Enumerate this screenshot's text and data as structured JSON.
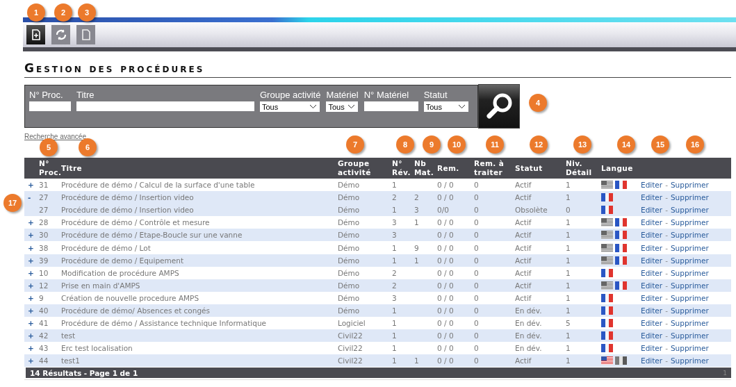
{
  "toolbar": {
    "buttons": [
      {
        "kind": "new",
        "selected": true
      },
      {
        "kind": "refresh",
        "selected": false
      },
      {
        "kind": "document",
        "selected": false
      }
    ]
  },
  "title": "Gestion des procédures",
  "filters": {
    "fields": [
      {
        "kind": "text",
        "label": "N° Proc."
      },
      {
        "kind": "text",
        "label": "Titre"
      },
      {
        "kind": "select",
        "label": "Groupe activité",
        "value": "Tous"
      },
      {
        "kind": "select",
        "label": "Matériel",
        "value": "Tous"
      },
      {
        "kind": "text",
        "label": "N° Matériel"
      },
      {
        "kind": "select",
        "label": "Statut",
        "value": "Tous"
      }
    ]
  },
  "advanced_search": "Recherche avancée",
  "table": {
    "columns": [
      "",
      "N°\nProc.",
      "Titre",
      "Groupe\nactivité",
      "N°\nRév.",
      "Nb\nMat.",
      "Rem.",
      "Rem. à\ntraiter",
      "Statut",
      "Niv.\nDétail",
      "Langue",
      ""
    ],
    "rows": [
      {
        "toggle": "+",
        "proc": "31",
        "titre": "Procédure de démo / Calcul de la surface d'une table",
        "groupe": "Démo",
        "rev": "1",
        "nb_mat": "",
        "rem": "0 / 0",
        "rem_traiter": "0",
        "statut": "Actif",
        "niv": "1",
        "langues": [
          {
            "kind": "us",
            "active": false
          },
          {
            "kind": "fr",
            "active": true
          }
        ],
        "edit": "Editer",
        "separator": "-",
        "delete": "Supprimer"
      },
      {
        "toggle": "-",
        "proc": "27",
        "titre": "Procédure de démo / Insertion video",
        "groupe": "Démo",
        "rev": "2",
        "nb_mat": "2",
        "rem": "0 / 0",
        "rem_traiter": "0",
        "statut": "Actif",
        "niv": "1",
        "langues": [
          {
            "kind": "fr",
            "active": true
          }
        ],
        "edit": "Editer",
        "separator": "-",
        "delete": "Supprimer"
      },
      {
        "proc": "27",
        "titre": "Procédure de démo / Insertion video",
        "groupe": "Démo",
        "rev": "1",
        "nb_mat": "3",
        "rem": "0/0",
        "rem_traiter": "0",
        "statut": "Obsolète",
        "niv": "0",
        "langues": [
          {
            "kind": "fr",
            "active": true
          }
        ],
        "edit": "Editer",
        "separator": "-",
        "delete": "Supprimer"
      },
      {
        "toggle": "+",
        "proc": "28",
        "titre": "Procédure de démo / Contrôle et mesure",
        "groupe": "Démo",
        "rev": "3",
        "nb_mat": "1",
        "rem": "0 / 0",
        "rem_traiter": "0",
        "statut": "Actif",
        "niv": "1",
        "langues": [
          {
            "kind": "us",
            "active": false
          },
          {
            "kind": "fr",
            "active": true
          }
        ],
        "edit": "Editer",
        "separator": "-",
        "delete": "Supprimer"
      },
      {
        "toggle": "+",
        "proc": "30",
        "titre": "Procédure de démo / Etape-Boucle sur une vanne",
        "groupe": "Démo",
        "rev": "3",
        "nb_mat": "",
        "rem": "0 / 0",
        "rem_traiter": "0",
        "statut": "Actif",
        "niv": "1",
        "langues": [
          {
            "kind": "us",
            "active": false
          },
          {
            "kind": "fr",
            "active": true
          }
        ],
        "edit": "Editer",
        "separator": "-",
        "delete": "Supprimer"
      },
      {
        "toggle": "+",
        "proc": "38",
        "titre": "Procédure de démo / Lot",
        "groupe": "Démo",
        "rev": "1",
        "nb_mat": "9",
        "rem": "0 / 0",
        "rem_traiter": "0",
        "statut": "Actif",
        "niv": "1",
        "langues": [
          {
            "kind": "us",
            "active": false
          },
          {
            "kind": "fr",
            "active": true
          }
        ],
        "edit": "Editer",
        "separator": "-",
        "delete": "Supprimer"
      },
      {
        "toggle": "+",
        "proc": "39",
        "titre": "Procédure de demo / Equipement",
        "groupe": "Démo",
        "rev": "1",
        "nb_mat": "1",
        "rem": "0 / 0",
        "rem_traiter": "0",
        "statut": "Actif",
        "niv": "1",
        "langues": [
          {
            "kind": "us",
            "active": false
          },
          {
            "kind": "fr",
            "active": true
          }
        ],
        "edit": "Editer",
        "separator": "-",
        "delete": "Supprimer"
      },
      {
        "toggle": "+",
        "proc": "10",
        "titre": "Modification de procédure AMPS",
        "groupe": "Démo",
        "rev": "2",
        "nb_mat": "",
        "rem": "0 / 0",
        "rem_traiter": "0",
        "statut": "Actif",
        "niv": "1",
        "langues": [
          {
            "kind": "fr",
            "active": true
          }
        ],
        "edit": "Editer",
        "separator": "-",
        "delete": "Supprimer"
      },
      {
        "toggle": "+",
        "proc": "12",
        "titre": "Prise en main d'AMPS",
        "groupe": "Démo",
        "rev": "2",
        "nb_mat": "",
        "rem": "0 / 0",
        "rem_traiter": "0",
        "statut": "Actif",
        "niv": "1",
        "langues": [
          {
            "kind": "us",
            "active": false
          },
          {
            "kind": "fr",
            "active": true
          }
        ],
        "edit": "Editer",
        "separator": "-",
        "delete": "Supprimer"
      },
      {
        "toggle": "+",
        "proc": "9",
        "titre": "Création de nouvelle procedure AMPS",
        "groupe": "Démo",
        "rev": "3",
        "nb_mat": "",
        "rem": "0 / 0",
        "rem_traiter": "0",
        "statut": "Actif",
        "niv": "1",
        "langues": [
          {
            "kind": "fr",
            "active": true
          }
        ],
        "edit": "Editer",
        "separator": "-",
        "delete": "Supprimer"
      },
      {
        "toggle": "+",
        "proc": "40",
        "titre": "Procédure de démo/ Absences et congés",
        "groupe": "Démo",
        "rev": "1",
        "nb_mat": "",
        "rem": "0 / 0",
        "rem_traiter": "0",
        "statut": "En dév.",
        "niv": "1",
        "langues": [
          {
            "kind": "fr",
            "active": true
          }
        ],
        "edit": "Editer",
        "separator": "-",
        "delete": "Supprimer"
      },
      {
        "toggle": "+",
        "proc": "41",
        "titre": "Procédure de démo / Assistance technique Informatique",
        "groupe": "Logiciel",
        "rev": "1",
        "nb_mat": "",
        "rem": "0 / 0",
        "rem_traiter": "0",
        "statut": "En dév.",
        "niv": "5",
        "langues": [
          {
            "kind": "fr",
            "active": true
          }
        ],
        "edit": "Editer",
        "separator": "-",
        "delete": "Supprimer"
      },
      {
        "toggle": "+",
        "proc": "42",
        "titre": "test",
        "groupe": "Civil22",
        "rev": "1",
        "nb_mat": "",
        "rem": "0 / 0",
        "rem_traiter": "0",
        "statut": "En dév.",
        "niv": "1",
        "langues": [
          {
            "kind": "fr",
            "active": true
          }
        ],
        "edit": "Editer",
        "separator": "-",
        "delete": "Supprimer"
      },
      {
        "toggle": "+",
        "proc": "43",
        "titre": "Erc test localisation",
        "groupe": "Civil22",
        "rev": "1",
        "nb_mat": "",
        "rem": "0 / 0",
        "rem_traiter": "0",
        "statut": "En dév.",
        "niv": "1",
        "langues": [
          {
            "kind": "fr",
            "active": true
          }
        ],
        "edit": "Editer",
        "separator": "-",
        "delete": "Supprimer"
      },
      {
        "toggle": "+",
        "proc": "44",
        "titre": "test1",
        "groupe": "Civil22",
        "rev": "1",
        "nb_mat": "1",
        "rem": "0 / 0",
        "rem_traiter": "0",
        "statut": "Actif",
        "niv": "1",
        "langues": [
          {
            "kind": "us",
            "active": true
          },
          {
            "kind": "fr",
            "active": false
          }
        ],
        "edit": "Editer",
        "separator": "-",
        "delete": "Supprimer"
      }
    ],
    "footer": "14 Résultats - Page 1 de 1",
    "page": "1"
  },
  "callouts": [
    {
      "label": "1"
    },
    {
      "label": "2"
    },
    {
      "label": "3"
    },
    {
      "label": "4"
    },
    {
      "label": "5"
    },
    {
      "label": "6"
    },
    {
      "label": "7"
    },
    {
      "label": "8"
    },
    {
      "label": "9"
    },
    {
      "label": "10"
    },
    {
      "label": "11"
    },
    {
      "label": "12"
    },
    {
      "label": "13"
    },
    {
      "label": "14"
    },
    {
      "label": "15"
    },
    {
      "label": "16"
    },
    {
      "label": "17"
    }
  ]
}
